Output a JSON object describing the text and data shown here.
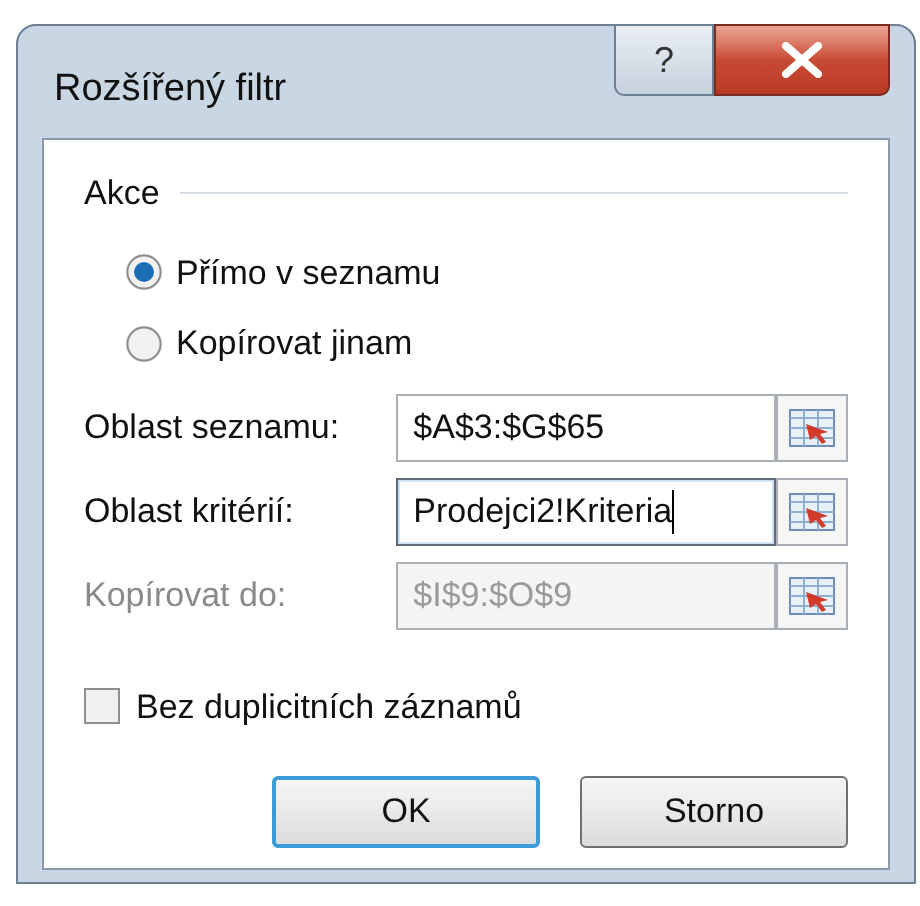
{
  "window": {
    "title": "Rozšířený filtr",
    "help_button": "?"
  },
  "action_group": {
    "title": "Akce",
    "options": [
      {
        "label": "Přímo v seznamu",
        "selected": true
      },
      {
        "label": "Kopírovat jinam",
        "selected": false
      }
    ]
  },
  "fields": [
    {
      "label": "Oblast seznamu:",
      "value": "$A$3:$G$65",
      "disabled": false,
      "focused": false
    },
    {
      "label": "Oblast kritérií:",
      "value": "Prodejci2!Kriteria",
      "disabled": false,
      "focused": true
    },
    {
      "label": "Kopírovat do:",
      "value": "$I$9:$O$9",
      "disabled": true,
      "focused": false
    }
  ],
  "unique_only": {
    "label": "Bez duplicitních záznamů",
    "checked": false
  },
  "buttons": [
    {
      "label": "OK",
      "default": true
    },
    {
      "label": "Storno",
      "default": false
    }
  ]
}
